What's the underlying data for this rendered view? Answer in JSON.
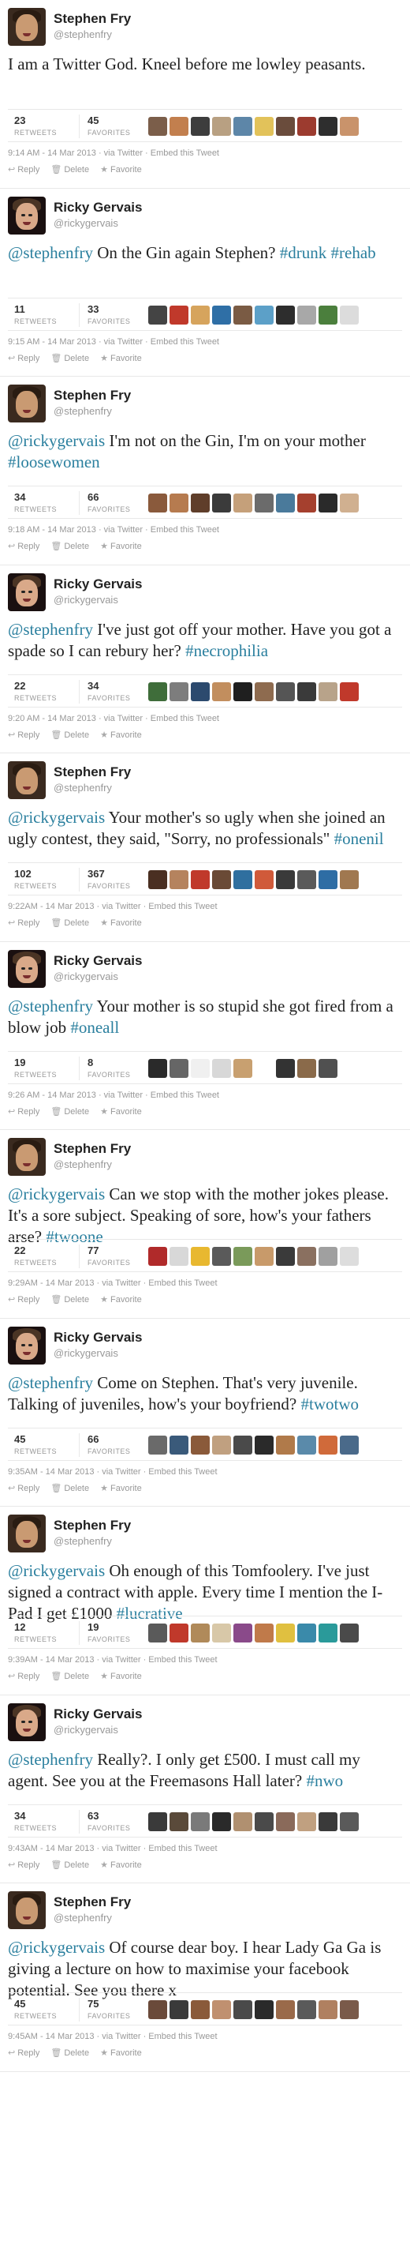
{
  "labels": {
    "retweets": "RETWEETS",
    "favorites": "FAVORITES",
    "reply": "Reply",
    "delete": "Delete",
    "favorite": "Favorite"
  },
  "icons": {
    "reply": "reply-arrow-icon",
    "delete": "trash-icon",
    "favorite": "star-icon"
  },
  "colors": {
    "link": "#2a7f9e",
    "meta": "#999999",
    "name": "#222222"
  },
  "tweets": [
    {
      "author": "fry",
      "fullname": "Stephen Fry",
      "screenname": "@stephenfry",
      "text_parts": [
        {
          "t": "I am a Twitter God. Kneel before me lowley peasants.",
          "k": "plain"
        }
      ],
      "retweets": "23",
      "favorites": "45",
      "meta": "9:14 AM - 14 Mar 2013 · via Twitter · Embed this Tweet",
      "faces": [
        "#7b5e4a",
        "#c27f4e",
        "#3d3d3d",
        "#b8a082",
        "#5d86a8",
        "#e2c25a",
        "#6a4c3c",
        "#9c3b2f",
        "#2e2e2e",
        "#c9936b"
      ]
    },
    {
      "author": "rg",
      "fullname": "Ricky Gervais",
      "screenname": "@rickygervais",
      "text_parts": [
        {
          "t": "@stephenfry",
          "k": "mention"
        },
        {
          "t": " On the Gin again Stephen? ",
          "k": "plain"
        },
        {
          "t": "#drunk",
          "k": "hashtag"
        },
        {
          "t": " ",
          "k": "plain"
        },
        {
          "t": "#rehab",
          "k": "hashtag"
        }
      ],
      "retweets": "11",
      "favorites": "33",
      "meta": "9:15 AM - 14 Mar 2013 · via Twitter · Embed this Tweet",
      "faces": [
        "#444444",
        "#c0392b",
        "#d6a45d",
        "#2f6fa6",
        "#7a5b44",
        "#5ca0c8",
        "#2d2d2d",
        "#a8a8a8",
        "#4b7f3d",
        "#dcdcdc"
      ]
    },
    {
      "author": "fry",
      "fullname": "Stephen Fry",
      "screenname": "@stephenfry",
      "text_parts": [
        {
          "t": "@rickygervais",
          "k": "mention"
        },
        {
          "t": " I'm not on the Gin, I'm on your mother ",
          "k": "plain"
        },
        {
          "t": "#loosewomen",
          "k": "hashtag"
        }
      ],
      "retweets": "34",
      "favorites": "66",
      "meta": "9:18 AM - 14 Mar 2013 · via Twitter · Embed this Tweet",
      "faces": [
        "#8a5a3c",
        "#b67b4f",
        "#5f3e2a",
        "#3b3b3b",
        "#c5a07a",
        "#6b6b6b",
        "#4a7a9b",
        "#a5402e",
        "#2a2a2a",
        "#d0b090"
      ]
    },
    {
      "author": "rg",
      "fullname": "Ricky Gervais",
      "screenname": "@rickygervais",
      "text_parts": [
        {
          "t": "@stephenfry",
          "k": "mention"
        },
        {
          "t": " I've just got off your mother. Have you got a spade so I can rebury her? ",
          "k": "plain"
        },
        {
          "t": "#necrophilia",
          "k": "hashtag"
        }
      ],
      "retweets": "22",
      "favorites": "34",
      "meta": "9:20 AM - 14 Mar 2013 · via Twitter · Embed this Tweet",
      "faces": [
        "#3f6d3a",
        "#7d7d7d",
        "#2c4a6e",
        "#c28e5e",
        "#1f1f1f",
        "#8e6b4f",
        "#555555",
        "#3a3a3a",
        "#b8a38a",
        "#c0392b"
      ]
    },
    {
      "author": "fry",
      "fullname": "Stephen Fry",
      "screenname": "@stephenfry",
      "text_parts": [
        {
          "t": "@rickygervais",
          "k": "mention"
        },
        {
          "t": " Your mother's so ugly when she joined an ugly contest, they said, \"Sorry, no professionals\" ",
          "k": "plain"
        },
        {
          "t": "#onenil",
          "k": "hashtag"
        }
      ],
      "retweets": "102",
      "favorites": "367",
      "meta": "9:22AM - 14 Mar 2013 · via Twitter · Embed this Tweet",
      "faces": [
        "#4a2f22",
        "#b5835e",
        "#c0392b",
        "#6a4a36",
        "#2f6f9f",
        "#d05a3a",
        "#3a3a3a",
        "#5a5a5a",
        "#2e6da4",
        "#a07850"
      ]
    },
    {
      "author": "rg",
      "fullname": "Ricky Gervais",
      "screenname": "@rickygervais",
      "text_parts": [
        {
          "t": "@stephenfry",
          "k": "mention"
        },
        {
          "t": " Your mother is so stupid she got fired from a blow job ",
          "k": "plain"
        },
        {
          "t": "#oneall",
          "k": "hashtag"
        }
      ],
      "retweets": "19",
      "favorites": "8",
      "meta": "9:26 AM - 14 Mar 2013 · via Twitter · Embed this Tweet",
      "faces": [
        "#2a2a2a",
        "#666666",
        "#f0f0f0",
        "#d8d8d8",
        "#c8a070",
        "#ffffff",
        "#333333",
        "#8a6a4a",
        "#505050"
      ]
    },
    {
      "author": "fry",
      "fullname": "Stephen Fry",
      "screenname": "@stephenfry",
      "text_parts": [
        {
          "t": "@rickygervais",
          "k": "mention"
        },
        {
          "t": " Can we stop with the mother jokes please. It's a sore subject. Speaking of sore, how's your fathers arse? ",
          "k": "plain"
        },
        {
          "t": "#twoone",
          "k": "hashtag"
        }
      ],
      "retweets": "22",
      "favorites": "77",
      "meta": "9:29AM - 14 Mar 2013 · via Twitter · Embed this Tweet",
      "faces": [
        "#b02a2a",
        "#d8d8d8",
        "#e8b830",
        "#5a5a5a",
        "#7a9a5a",
        "#c89a6a",
        "#3a3a3a",
        "#8a7060",
        "#a0a0a0",
        "#dddddd"
      ]
    },
    {
      "author": "rg",
      "fullname": "Ricky Gervais",
      "screenname": "@rickygervais",
      "text_parts": [
        {
          "t": "@stephenfry",
          "k": "mention"
        },
        {
          "t": " Come on Stephen. That's very juvenile. Talking of juveniles, how's your boyfriend? ",
          "k": "plain"
        },
        {
          "t": "#twotwo",
          "k": "hashtag"
        }
      ],
      "retweets": "45",
      "favorites": "66",
      "meta": "9:35AM - 14 Mar 2013 · via Twitter · Embed this Tweet",
      "faces": [
        "#6a6a6a",
        "#3a5a7a",
        "#8a5a3a",
        "#c0a080",
        "#4a4a4a",
        "#2a2a2a",
        "#b07a4a",
        "#5a8aaa",
        "#d06a3a",
        "#4a6a8a"
      ]
    },
    {
      "author": "fry",
      "fullname": "Stephen Fry",
      "screenname": "@stephenfry",
      "text_parts": [
        {
          "t": "@rickygervais",
          "k": "mention"
        },
        {
          "t": " Oh enough of this Tomfoolery. I've just signed a contract with apple. Every time I mention the I-Pad I get £1000 ",
          "k": "plain"
        },
        {
          "t": "#lucrative",
          "k": "hashtag"
        }
      ],
      "retweets": "12",
      "favorites": "19",
      "meta": "9:39AM - 14 Mar 2013 · via Twitter · Embed this Tweet",
      "faces": [
        "#5a5a5a",
        "#c0392b",
        "#b08a5a",
        "#d8c8a8",
        "#8a4a8a",
        "#c07a4a",
        "#e0c040",
        "#3a8aaa",
        "#2a9a9a",
        "#4a4a4a"
      ]
    },
    {
      "author": "rg",
      "fullname": "Ricky Gervais",
      "screenname": "@rickygervais",
      "text_parts": [
        {
          "t": "@stephenfry",
          "k": "mention"
        },
        {
          "t": " Really?. I only get £500. I must call my agent. See you at the Freemasons Hall later? ",
          "k": "plain"
        },
        {
          "t": "#nwo",
          "k": "hashtag"
        }
      ],
      "retweets": "34",
      "favorites": "63",
      "meta": "9:43AM - 14 Mar 2013 · via Twitter · Embed this Tweet",
      "faces": [
        "#3a3a3a",
        "#5a4a3a",
        "#7a7a7a",
        "#2a2a2a",
        "#b09070",
        "#4a4a4a",
        "#8a6a5a",
        "#c0a080",
        "#3a3a3a",
        "#5a5a5a"
      ]
    },
    {
      "author": "fry",
      "fullname": "Stephen Fry",
      "screenname": "@stephenfry",
      "text_parts": [
        {
          "t": "@rickygervais",
          "k": "mention"
        },
        {
          "t": " Of course dear boy. I hear Lady Ga Ga is giving a lecture on how to maximise your facebook potential. See you there x",
          "k": "plain"
        }
      ],
      "retweets": "45",
      "favorites": "75",
      "meta": "9:45AM - 14 Mar 2013 · via Twitter · Embed this Tweet",
      "faces": [
        "#6a4a3a",
        "#3a3a3a",
        "#8a5a3a",
        "#c09070",
        "#4a4a4a",
        "#2a2a2a",
        "#9a6a4a",
        "#5a5a5a",
        "#b08060",
        "#7a5a4a"
      ]
    }
  ]
}
